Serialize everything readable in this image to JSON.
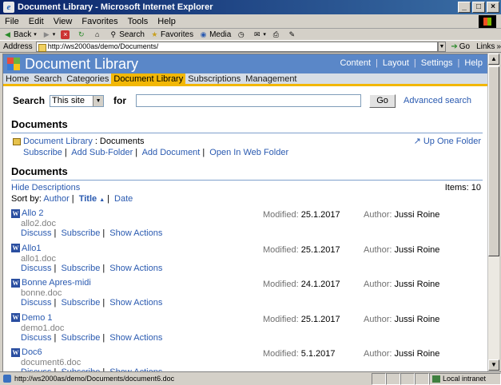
{
  "window": {
    "title": "Document Library - Microsoft Internet Explorer"
  },
  "menu": [
    "File",
    "Edit",
    "View",
    "Favorites",
    "Tools",
    "Help"
  ],
  "toolbar": {
    "back": "Back",
    "search": "Search",
    "favorites": "Favorites",
    "media": "Media"
  },
  "address": {
    "label": "Address",
    "url": "http://ws2000as/demo/Documents/",
    "go": "Go",
    "links": "Links"
  },
  "site": {
    "title": "Document Library",
    "util_links": [
      "Content",
      "Layout",
      "Settings",
      "Help"
    ],
    "tabs": [
      "Home",
      "Search",
      "Categories",
      "Document Library",
      "Subscriptions",
      "Management"
    ],
    "active_tab": "Document Library"
  },
  "search": {
    "label": "Search",
    "scope": "This site",
    "for": "for",
    "go": "Go",
    "advanced": "Advanced search"
  },
  "folder_section": {
    "heading": "Documents",
    "crumb_parent": "Document Library",
    "crumb_sep": ":",
    "crumb_current": "Documents",
    "up": "Up One Folder",
    "actions": [
      "Subscribe",
      "Add Sub-Folder",
      "Add Document",
      "Open In Web Folder"
    ]
  },
  "docs_section": {
    "heading": "Documents",
    "hide_desc": "Hide Descriptions",
    "items_label": "Items:",
    "items_count": "10",
    "sort_label": "Sort by:",
    "sort_author": "Author",
    "sort_title": "Title",
    "sort_date": "Date"
  },
  "labels": {
    "modified": "Modified:",
    "author": "Author:"
  },
  "doc_actions": [
    "Discuss",
    "Subscribe",
    "Show Actions"
  ],
  "documents": [
    {
      "title": "Allo 2",
      "file": "allo2.doc",
      "modified": "25.1.2017",
      "author": "Jussi Roine"
    },
    {
      "title": "Allo1",
      "file": "allo1.doc",
      "modified": "25.1.2017",
      "author": "Jussi Roine"
    },
    {
      "title": "Bonne Apres-midi",
      "file": "bonne.doc",
      "modified": "24.1.2017",
      "author": "Jussi Roine"
    },
    {
      "title": "Demo 1",
      "file": "demo1.doc",
      "modified": "25.1.2017",
      "author": "Jussi Roine"
    },
    {
      "title": "Doc6",
      "file": "document6.doc",
      "modified": "5.1.2017",
      "author": "Jussi Roine"
    }
  ],
  "status": {
    "url": "http://ws2000as/demo/Documents/document6.doc",
    "zone": "Local intranet"
  }
}
